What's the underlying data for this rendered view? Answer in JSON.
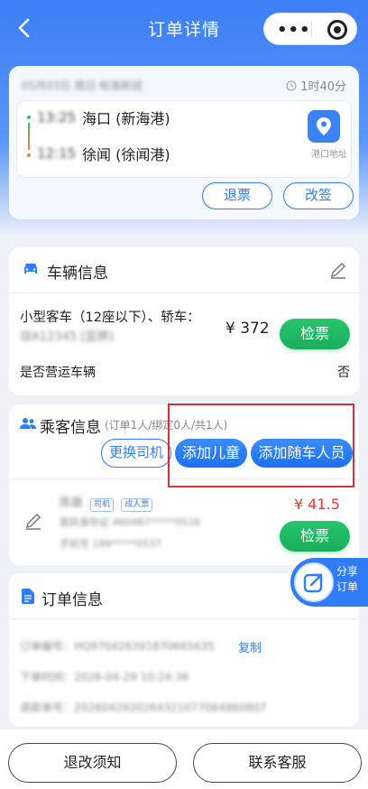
{
  "nav": {
    "title": "订单详情",
    "more_glyph": "•••"
  },
  "trip": {
    "date": "05月03日 周日 标准航班",
    "duration": "1时40分",
    "depart_time": "13:25",
    "depart_port": "海口 (新海港)",
    "arrive_time": "12:15",
    "arrive_port": "徐闻 (徐闻港)",
    "port_address_label": "港口地址",
    "refund_label": "退票",
    "change_label": "改签"
  },
  "vehicle": {
    "title": "车辆信息",
    "type": "小型客车（12座以下）、轿车：",
    "plate": "琼A12345 [蓝牌]",
    "price": "¥ 372",
    "check_label": "检票",
    "operating_label": "是否营运车辆",
    "operating_value": "否"
  },
  "passenger": {
    "title": "乘客信息",
    "summary": "(订单1人/绑定0人/共1人)",
    "change_driver": "更换司机",
    "add_child": "添加儿童",
    "add_companion": "添加随车人员",
    "name": "陈晨",
    "tag_driver": "司机",
    "tag_adult": "成人票",
    "id_line": "居民身份证 460487*****0516",
    "phone_line": "手机号 189*****0537",
    "price": "¥ 41.5",
    "check_label": "检票"
  },
  "share": {
    "label": "分享订单"
  },
  "order": {
    "title": "订单信息",
    "order_no_label": "订单编号：",
    "order_no": "HQ970426391870665635",
    "copy_label": "复制",
    "time_label": "下单时间：",
    "time": "2026-04-29 10:24:36",
    "pay_label": "退款单号：",
    "pay_no": "2026042920264321077064860807"
  },
  "bottom": {
    "refund_notice": "退改须知",
    "contact": "联系客服"
  },
  "colors": {
    "primary": "#2f7cf6",
    "green": "#1aae5a",
    "price_red": "#f0392b",
    "highlight": "#d0343a"
  }
}
